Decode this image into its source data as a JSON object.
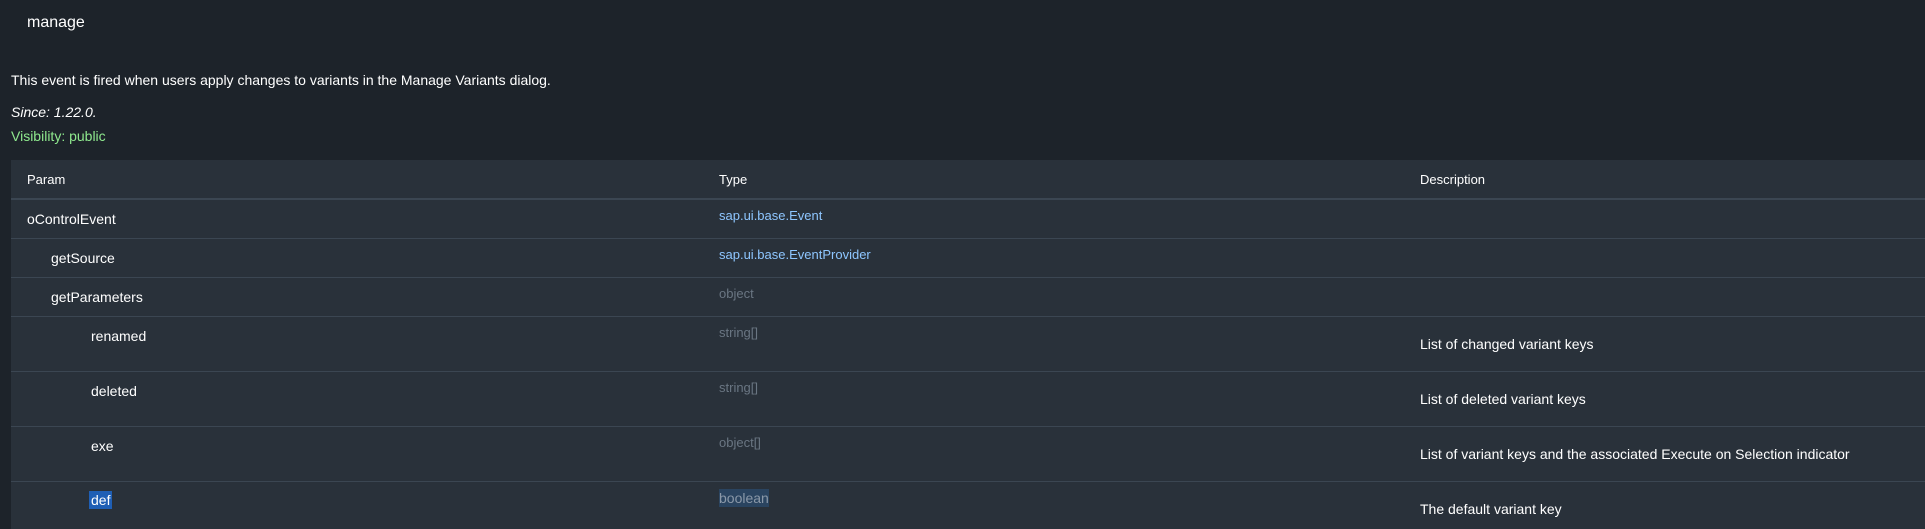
{
  "event": {
    "title": "manage",
    "description": "This event is fired when users apply changes to variants in the Manage Variants dialog.",
    "since": "Since: 1.22.0.",
    "visibility": "Visibility: public"
  },
  "table": {
    "headers": {
      "param": "Param",
      "type": "Type",
      "description": "Description"
    },
    "rows": [
      {
        "param": "oControlEvent",
        "type": "sap.ui.base.Event",
        "description": ""
      },
      {
        "param": "getSource",
        "type": "sap.ui.base.EventProvider",
        "description": ""
      },
      {
        "param": "getParameters",
        "type": "object",
        "description": ""
      },
      {
        "param": "renamed",
        "type": "string[]",
        "description": "List of changed variant keys"
      },
      {
        "param": "deleted",
        "type": "string[]",
        "description": "List of deleted variant keys"
      },
      {
        "param": "exe",
        "type": "object[]",
        "description": "List of variant keys and the associated Execute on Selection indicator"
      },
      {
        "param": "def",
        "type": "boolean",
        "description": "The default variant key"
      }
    ]
  },
  "colors": {
    "background": "#1d232a",
    "table_bg": "#29313a",
    "link": "#8ec6ff",
    "visibility": "#8fe98e",
    "muted_type": "#6a7683",
    "selection": "#1f5fb5"
  }
}
